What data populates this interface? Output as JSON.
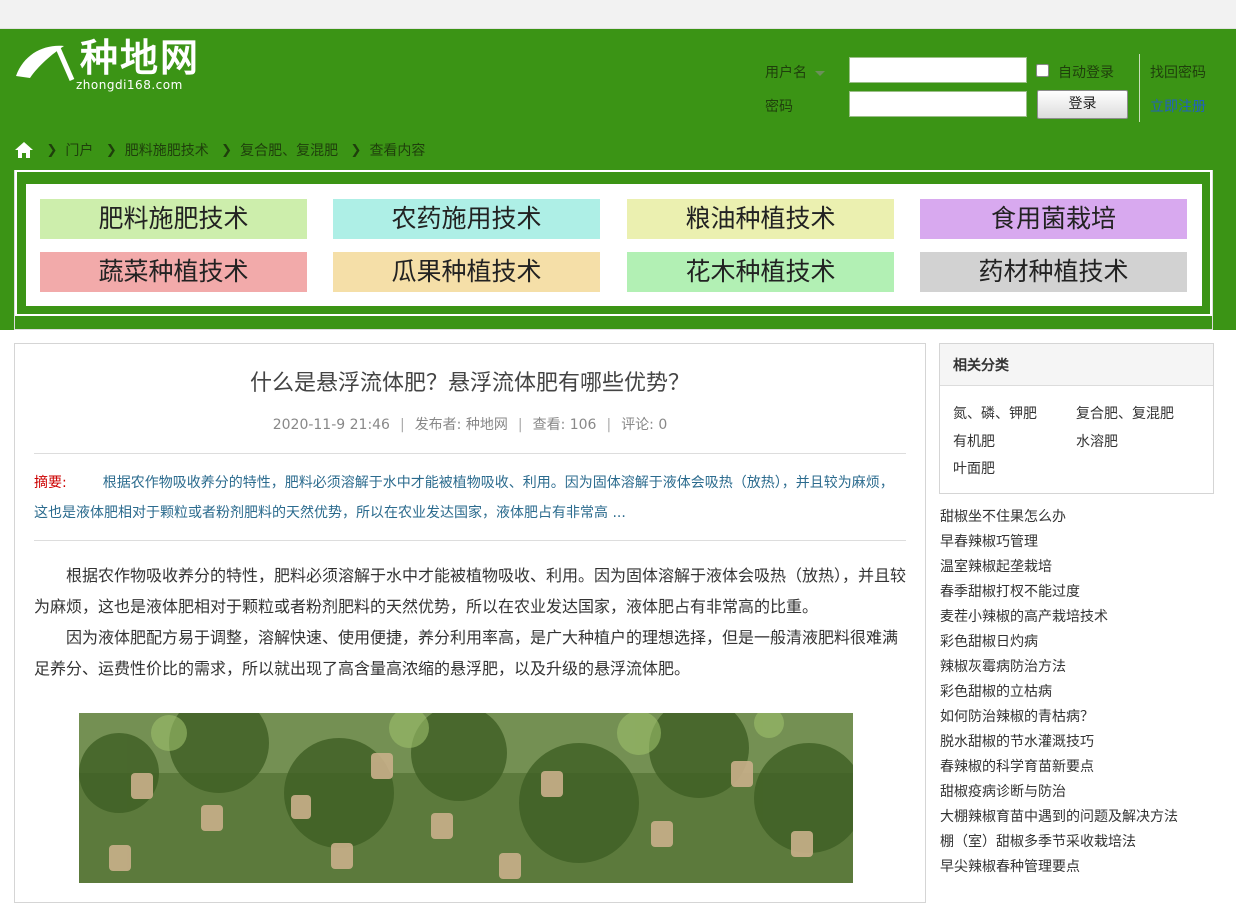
{
  "logo": {
    "text_cn": "种地网",
    "text_en": "zhongdi168.com"
  },
  "login": {
    "username_label": "用户名",
    "password_label": "密码",
    "auto_login": "自动登录",
    "login_button": "登录",
    "find_password": "找回密码",
    "register": "立即注册"
  },
  "breadcrumb": [
    "门户",
    "肥料施肥技术",
    "复合肥、复混肥",
    "查看内容"
  ],
  "categories": [
    {
      "label": "肥料施肥技术",
      "color": "#cdeeac"
    },
    {
      "label": "农药施用技术",
      "color": "#aeefe6"
    },
    {
      "label": "粮油种植技术",
      "color": "#ebf0b0"
    },
    {
      "label": "食用菌栽培",
      "color": "#d8a9ef"
    },
    {
      "label": "蔬菜种植技术",
      "color": "#f2aaaa"
    },
    {
      "label": "瓜果种植技术",
      "color": "#f5dfa8"
    },
    {
      "label": "花木种植技术",
      "color": "#b2f0b4"
    },
    {
      "label": "药材种植技术",
      "color": "#d2d2d2"
    }
  ],
  "article": {
    "title": "什么是悬浮流体肥？悬浮流体肥有哪些优势？",
    "date": "2020-11-9 21:46",
    "author": "发布者: 种地网",
    "views": "查看: 106",
    "comments": "评论: 0",
    "summary_label": "摘要:",
    "summary": "根据农作物吸收养分的特性，肥料必须溶解于水中才能被植物吸收、利用。因为固体溶解于液体会吸热（放热），并且较为麻烦，这也是液体肥相对于颗粒或者粉剂肥料的天然优势，所以在农业发达国家，液体肥占有非常高 ...",
    "paragraphs": [
      "根据农作物吸收养分的特性，肥料必须溶解于水中才能被植物吸收、利用。因为固体溶解于液体会吸热（放热），并且较为麻烦，这也是液体肥相对于颗粒或者粉剂肥料的天然优势，所以在农业发达国家，液体肥占有非常高的比重。",
      "因为液体肥配方易于调整，溶解快速、使用便捷，养分利用率高，是广大种植户的理想选择，但是一般清液肥料很难满足养分、运费性价比的需求，所以就出现了高含量高浓缩的悬浮肥，以及升级的悬浮流体肥。"
    ]
  },
  "sidebar": {
    "title": "相关分类",
    "categories": [
      "氮、磷、钾肥",
      "复合肥、复混肥",
      "有机肥",
      "水溶肥",
      "叶面肥"
    ],
    "links": [
      "甜椒坐不住果怎么办",
      "早春辣椒巧管理",
      "温室辣椒起垄栽培",
      "春季甜椒打杈不能过度",
      "麦茬小辣椒的高产栽培技术",
      "彩色甜椒日灼病",
      "辣椒灰霉病防治方法",
      "彩色甜椒的立枯病",
      "如何防治辣椒的青枯病？",
      "脱水甜椒的节水灌溉技巧",
      "春辣椒的科学育苗新要点",
      "甜椒疫病诊断与防治",
      "大棚辣椒育苗中遇到的问题及解决方法",
      "棚（室）甜椒多季节采收栽培法",
      "早尖辣椒春种管理要点"
    ]
  }
}
